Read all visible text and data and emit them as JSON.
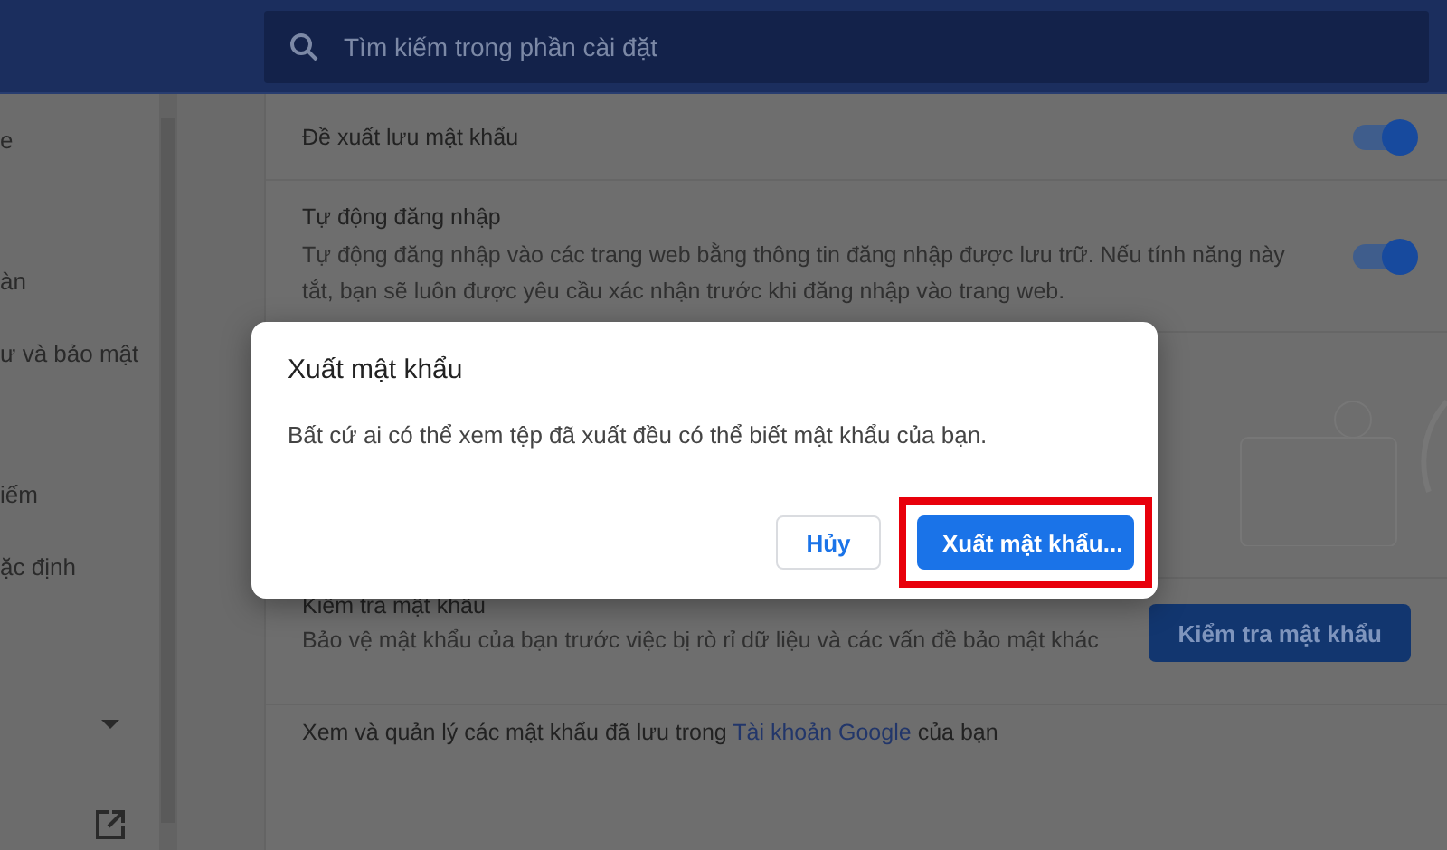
{
  "search": {
    "placeholder": "Tìm kiếm trong phần cài đặt"
  },
  "sidebar": {
    "items": [
      "e",
      "àn",
      "ư và bảo mật",
      "iếm",
      "ặc định"
    ]
  },
  "settings": [
    {
      "kind": "toggle",
      "title": "Đề xuất lưu mật khẩu",
      "on": true
    },
    {
      "kind": "toggle",
      "title": "Tự động đăng nhập",
      "description": "Tự động đăng nhập vào các trang web bằng thông tin đăng nhập được lưu trữ. Nếu tính năng này tắt, bạn sẽ luôn được yêu cầu xác nhận trước khi đăng nhập vào trang web.",
      "on": true
    },
    {
      "kind": "illustration"
    },
    {
      "kind": "button",
      "title": "Kiểm tra mật khẩu",
      "description": "Bảo vệ mật khẩu của bạn trước việc bị rò rỉ dữ liệu và các vấn đề bảo mật khác",
      "button": "Kiểm tra mật khẩu"
    },
    {
      "kind": "link",
      "text_before": "Xem và quản lý các mật khẩu đã lưu trong",
      "link": "Tài khoản Google",
      "text_after": "của bạn"
    }
  ],
  "dialog": {
    "title": "Xuất mật khẩu",
    "message": "Bất cứ ai có thể xem tệp đã xuất đều có thể biết mật khẩu của bạn.",
    "buttons": [
      {
        "label": "Hủy",
        "kind": "secondary"
      },
      {
        "label": "Xuất mật khẩu...",
        "kind": "primary",
        "highlighted": true
      }
    ]
  }
}
